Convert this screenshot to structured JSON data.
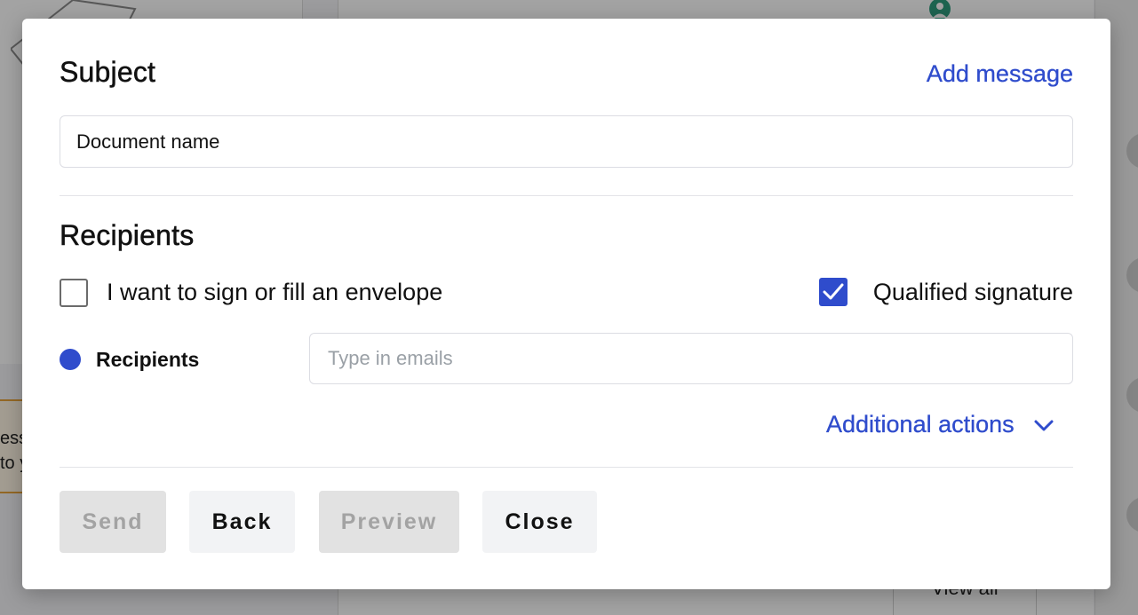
{
  "background": {
    "warning_lines": [
      "ess",
      "to y"
    ],
    "view_all_label": "View all"
  },
  "modal": {
    "subject": {
      "title": "Subject",
      "add_message_link": "Add message",
      "input_value": "Document name"
    },
    "recipients": {
      "title": "Recipients",
      "sign_checkbox": {
        "label": "I want to sign or fill an envelope",
        "checked": false
      },
      "qualified_checkbox": {
        "label": "Qualified signature",
        "checked": true
      },
      "recipient_label": "Recipients",
      "email_placeholder": "Type in emails",
      "additional_actions": "Additional actions"
    },
    "buttons": {
      "send": "Send",
      "back": "Back",
      "preview": "Preview",
      "close": "Close"
    }
  },
  "colors": {
    "accent": "#2f4ccc",
    "disabled_bg": "#e2e2e2",
    "disabled_text": "#a3a3a3"
  }
}
